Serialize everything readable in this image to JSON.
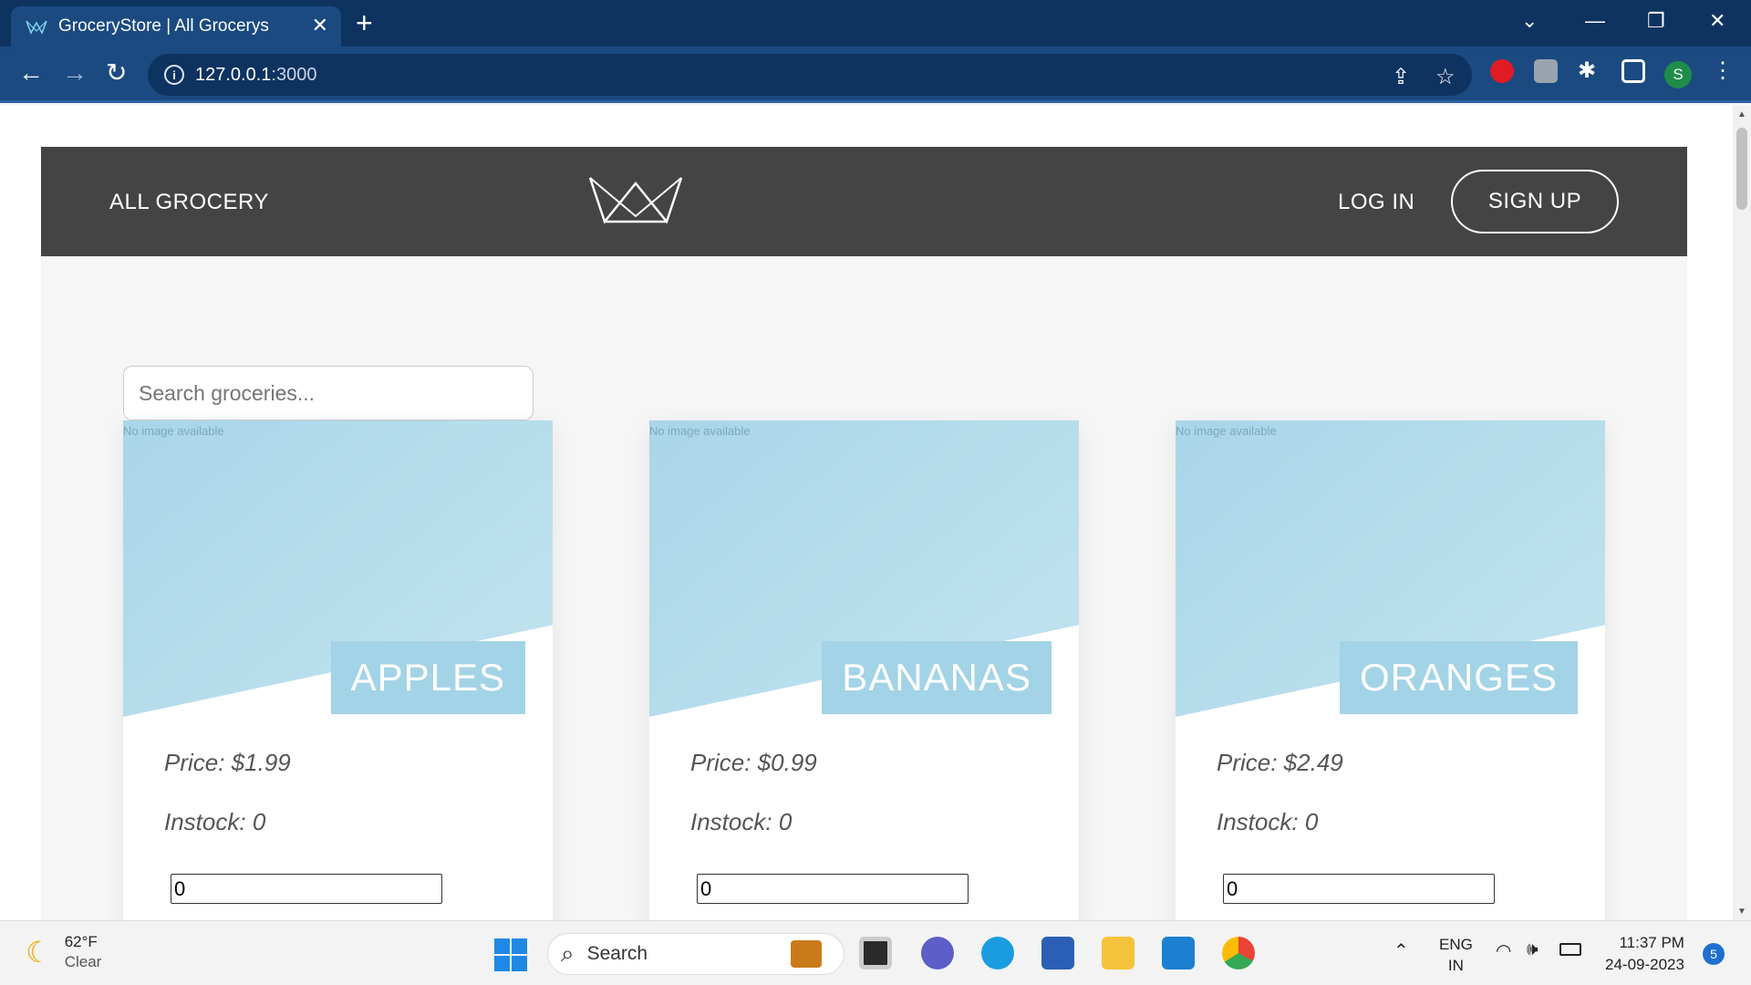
{
  "browser": {
    "tab_title": "GroceryStore | All Grocerys",
    "tab_close": "✕",
    "new_tab": "+",
    "url_host": "127.0.0.1",
    "url_port": ":3000",
    "profile_initial": "S"
  },
  "site": {
    "nav": {
      "all_grocery": "ALL GROCERY",
      "login": "LOG IN",
      "signup": "SIGN UP"
    },
    "search_placeholder": "Search groceries...",
    "products": [
      {
        "no_image": "No image available",
        "name": "APPLES",
        "price": "Price: $1.99",
        "stock": "Instock: 0",
        "qty": "0"
      },
      {
        "no_image": "No image available",
        "name": "BANANAS",
        "price": "Price: $0.99",
        "stock": "Instock: 0",
        "qty": "0"
      },
      {
        "no_image": "No image available",
        "name": "ORANGES",
        "price": "Price: $2.49",
        "stock": "Instock: 0",
        "qty": "0"
      }
    ]
  },
  "taskbar": {
    "weather_temp": "62°F",
    "weather_cond": "Clear",
    "search_label": "Search",
    "lang_top": "ENG",
    "lang_bottom": "IN",
    "time": "11:37 PM",
    "date": "24-09-2023",
    "notifications": "5"
  },
  "colors": {
    "nav_bg": "#444444",
    "card_image": "#a9d6e8",
    "name_tag": "#a3d3e6",
    "chrome_frame": "#0e3360",
    "chrome_toolbar": "#1a4a80"
  }
}
